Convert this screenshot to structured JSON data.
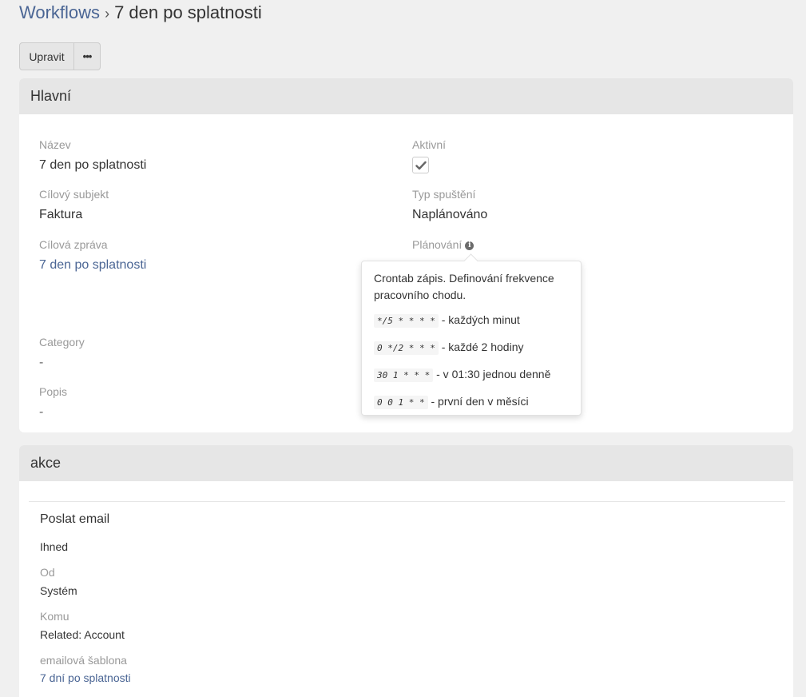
{
  "breadcrumb": {
    "root": "Workflows",
    "separator": "›",
    "current": "7 den po splatnosti"
  },
  "toolbar": {
    "edit_label": "Upravit",
    "more_label": "•••"
  },
  "main_panel": {
    "title": "Hlavní",
    "fields": {
      "name": {
        "label": "Název",
        "value": "7 den po splatnosti"
      },
      "active": {
        "label": "Aktivní",
        "checked": true
      },
      "target_entity": {
        "label": "Cílový subjekt",
        "value": "Faktura"
      },
      "trigger_type": {
        "label": "Typ spuštění",
        "value": "Naplánováno"
      },
      "target_report": {
        "label": "Cílová zpráva",
        "value": "7 den po splatnosti"
      },
      "scheduling": {
        "label": "Plánování"
      },
      "category": {
        "label": "Category",
        "value": "-"
      },
      "description": {
        "label": "Popis",
        "value": "-"
      }
    }
  },
  "tooltip": {
    "intro": "Crontab zápis. Definování frekvence pracovního chodu.",
    "examples": [
      {
        "code": "*/5 * * * *",
        "text": "- každých minut"
      },
      {
        "code": "0 */2 * * *",
        "text": "- každé 2 hodiny"
      },
      {
        "code": "30 1 * * *",
        "text": "- v 01:30 jednou denně"
      },
      {
        "code": "0 0 1 * *",
        "text": "- první den v měsíci"
      }
    ]
  },
  "actions_panel": {
    "title": "akce",
    "action": {
      "title": "Poslat email",
      "timing": "Ihned",
      "from_label": "Od",
      "from_value": "Systém",
      "to_label": "Komu",
      "to_value": "Related: Account",
      "template_label": "emailová šablona",
      "template_value": "7 dní po splatnosti"
    }
  }
}
